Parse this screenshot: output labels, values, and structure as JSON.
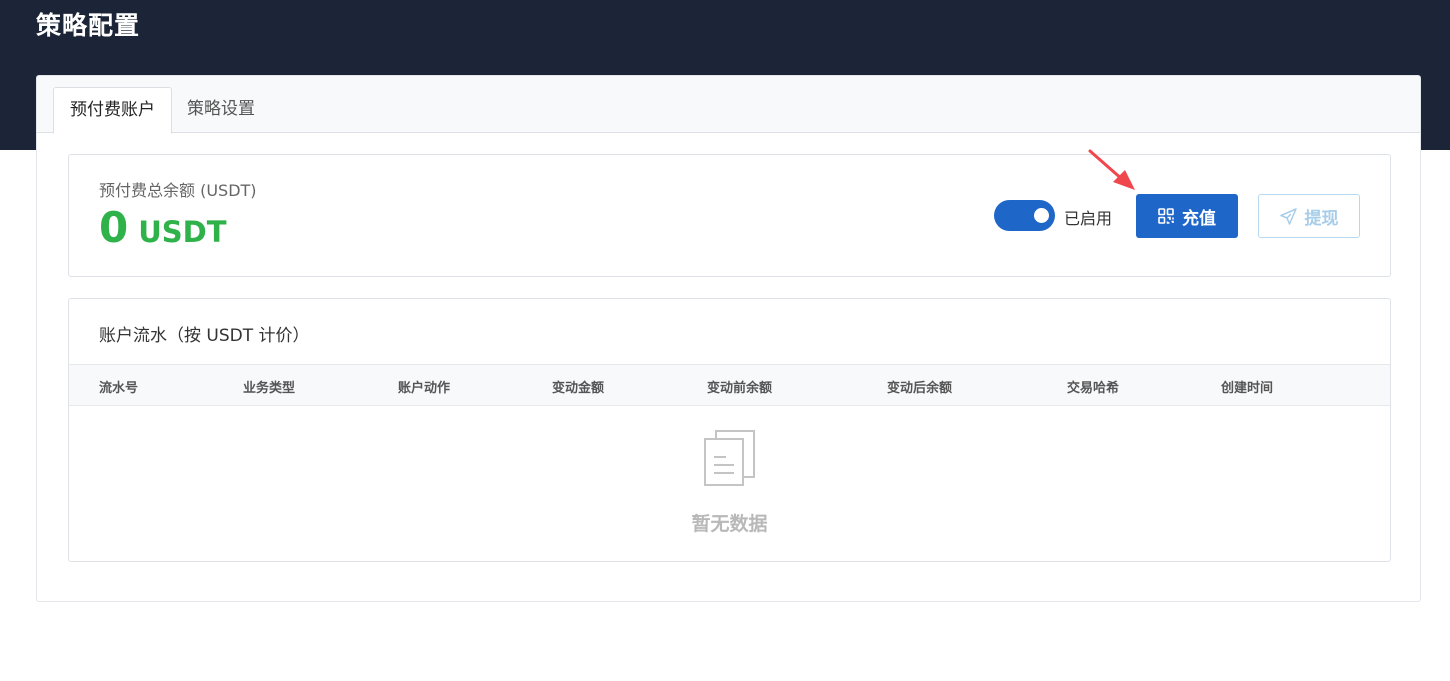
{
  "header": {
    "title": "策略配置"
  },
  "tabs": [
    {
      "label": "预付费账户",
      "active": true
    },
    {
      "label": "策略设置",
      "active": false
    }
  ],
  "balance": {
    "label": "预付费总余额 (USDT)",
    "amount": "0",
    "unit": "USDT",
    "toggle_on": true,
    "toggle_label": "已启用",
    "recharge_label": "充值",
    "withdraw_label": "提现",
    "recharge_icon": "qrcode-icon",
    "withdraw_icon": "send-icon"
  },
  "ledger": {
    "title": "账户流水（按 USDT 计价）",
    "columns": [
      "流水号",
      "业务类型",
      "账户动作",
      "变动金额",
      "变动前余额",
      "变动后余额",
      "交易哈希",
      "创建时间"
    ],
    "rows": [],
    "empty_text": "暂无数据",
    "empty_icon": "empty-documents-icon"
  },
  "colors": {
    "header_bg": "#1b2537",
    "primary": "#1f66c9",
    "balance_green": "#2fb24a",
    "annotation_red": "#f0474d"
  }
}
